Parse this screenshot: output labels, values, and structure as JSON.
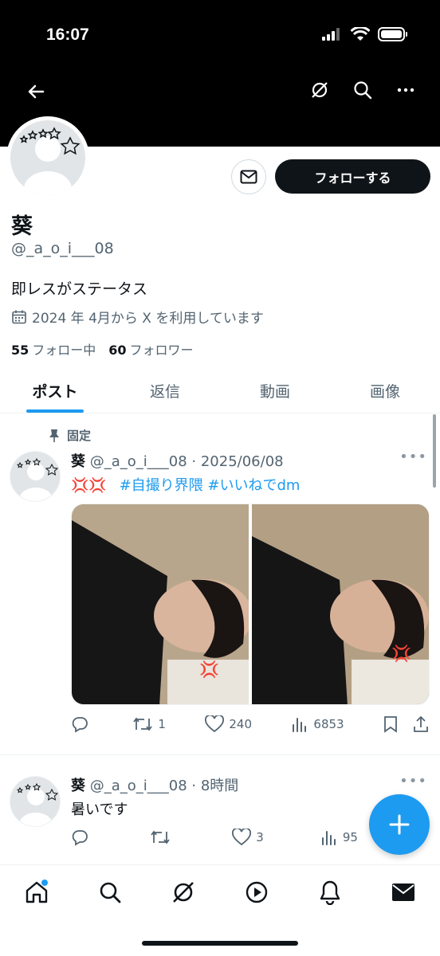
{
  "status_bar": {
    "time": "16:07"
  },
  "profile": {
    "display_name": "葵",
    "handle": "@_a_o_i___08",
    "bio": "即レスがステータス",
    "joined": "2024 年 4月から X を利用しています",
    "following_count": "55",
    "following_label": "フォロー中",
    "followers_count": "60",
    "followers_label": "フォロワー",
    "follow_button": "フォローする"
  },
  "tabs": [
    {
      "label": "ポスト",
      "active": true
    },
    {
      "label": "返信",
      "active": false
    },
    {
      "label": "動画",
      "active": false
    },
    {
      "label": "画像",
      "active": false
    }
  ],
  "posts": [
    {
      "pinned_label": "固定",
      "name": "葵",
      "meta": "@_a_o_i___08 · 2025/06/08",
      "text_emoji": "💢💢",
      "hashtags": "#自撮り界隈 #いいねでdm",
      "replies": "",
      "reposts": "1",
      "likes": "240",
      "views": "6853"
    },
    {
      "name": "葵",
      "meta": "@_a_o_i___08 · 8時間",
      "text": "暑いです",
      "replies": "",
      "reposts": "",
      "likes": "3",
      "views": "95"
    }
  ],
  "colors": {
    "accent": "#1d9bf0",
    "text": "#0f1419",
    "muted": "#536471",
    "banner": "#000000"
  },
  "icons": {
    "back": "arrow-left-icon",
    "grok": "grok-icon",
    "search": "search-icon",
    "more": "more-icon",
    "message": "envelope-icon",
    "calendar": "calendar-icon",
    "pin": "pin-icon",
    "compose": "plus-icon",
    "home": "home-icon",
    "explore": "search-icon",
    "video": "play-icon",
    "notifications": "bell-icon",
    "messages": "envelope-icon"
  }
}
